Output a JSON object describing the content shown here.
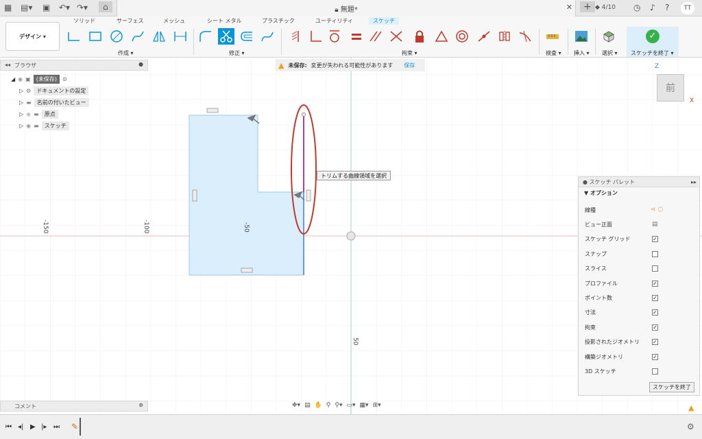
{
  "window": {
    "title": "無題*",
    "job_count": "4/10",
    "user_initials": "TT"
  },
  "workspace_tabs": [
    "ソリッド",
    "サーフェス",
    "メッシュ",
    "シート メタル",
    "プラスチック",
    "ユーティリティ",
    "スケッチ"
  ],
  "active_tab": "スケッチ",
  "design_button": "デザイン ▾",
  "tool_groups": {
    "create": "作成 ▾",
    "modify": "修正 ▾",
    "constraints": "拘束 ▾",
    "inspect": "検査 ▾",
    "insert": "挿入 ▾",
    "select": "選択 ▾",
    "finish": "スケッチを終了 ▾"
  },
  "browser": {
    "title": "ブラウザ",
    "items": [
      {
        "label": "(未保存)"
      },
      {
        "label": "ドキュメントの設定"
      },
      {
        "label": "名前の付いたビュー"
      },
      {
        "label": "原点"
      },
      {
        "label": "スケッチ"
      }
    ]
  },
  "comments": "コメント",
  "unsaved_banner": {
    "label": "未保存:",
    "message": "変更が失われる可能性があります",
    "save": "保存"
  },
  "tooltip": "トリムする曲線領域を選択",
  "axis_labels": [
    "-150",
    "-100",
    "-50",
    "50"
  ],
  "viewcube": {
    "face": "前",
    "z": "Z",
    "x": "X"
  },
  "palette": {
    "title": "スケッチ パレット",
    "section": "オプション",
    "rows": [
      {
        "label": "線種",
        "checked": null
      },
      {
        "label": "ビュー正面",
        "checked": null
      },
      {
        "label": "スケッチ グリッド",
        "checked": true
      },
      {
        "label": "スナップ",
        "checked": false
      },
      {
        "label": "スライス",
        "checked": false
      },
      {
        "label": "プロファイル",
        "checked": true
      },
      {
        "label": "ポイント数",
        "checked": true
      },
      {
        "label": "寸法",
        "checked": true
      },
      {
        "label": "拘束",
        "checked": true
      },
      {
        "label": "投影されたジオメトリ",
        "checked": true
      },
      {
        "label": "構築ジオメトリ",
        "checked": true
      },
      {
        "label": "3D スケッチ",
        "checked": false
      }
    ],
    "finish": "スケッチを終了"
  },
  "colors": {
    "accent": "#0696d7",
    "profile_fill": "#dbeefb",
    "profile_edge": "#5fa8e0",
    "selected_line": "#a03080",
    "highlight": "#c0392b"
  }
}
